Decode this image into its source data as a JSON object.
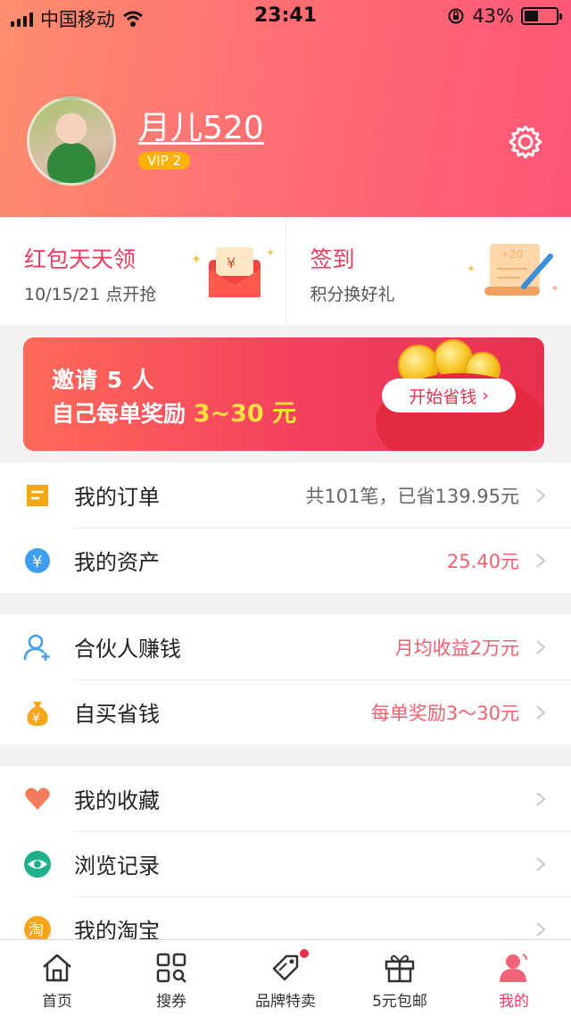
{
  "status_bar": {
    "carrier": "中国移动",
    "time": "23:41",
    "battery": "43%",
    "battery_level": 0.43
  },
  "profile": {
    "username": "月儿520",
    "vip": "VIP 2"
  },
  "quick_cards": [
    {
      "title": "红包天天领",
      "subtitle": "10/15/21 点开抢"
    },
    {
      "title": "签到",
      "subtitle": "积分换好礼"
    }
  ],
  "banner": {
    "line1": "邀请 5 人",
    "line2_prefix": "自己每单奖励 ",
    "line2_highlight": "3~30 元",
    "button": "开始省钱"
  },
  "menu_group_1": [
    {
      "label": "我的订单",
      "value": "共101笔，已省139.95元",
      "icon": "order-icon"
    },
    {
      "label": "我的资产",
      "value": "25.40元",
      "icon": "yuan-icon"
    }
  ],
  "menu_group_2": [
    {
      "label": "合伙人赚钱",
      "value": "月均收益2万元",
      "icon": "add-user-icon"
    },
    {
      "label": "自买省钱",
      "value": "每单奖励3～30元",
      "icon": "money-bag-icon"
    }
  ],
  "menu_group_3": [
    {
      "label": "我的收藏",
      "value": "",
      "icon": "heart-icon"
    },
    {
      "label": "浏览记录",
      "value": "",
      "icon": "eye-icon"
    },
    {
      "label": "我的淘宝",
      "value": "",
      "icon": "taobao-icon",
      "icon_text": "淘"
    }
  ],
  "tabs": [
    {
      "label": "首页",
      "icon": "home-icon"
    },
    {
      "label": "搜券",
      "icon": "search-coupon-icon"
    },
    {
      "label": "品牌特卖",
      "icon": "tag-icon"
    },
    {
      "label": "5元包邮",
      "icon": "gift-icon"
    },
    {
      "label": "我的",
      "icon": "profile-icon"
    }
  ],
  "colors": {
    "accent": "#e83d5f",
    "value_red": "#f0616e",
    "value_gray": "#666666"
  }
}
